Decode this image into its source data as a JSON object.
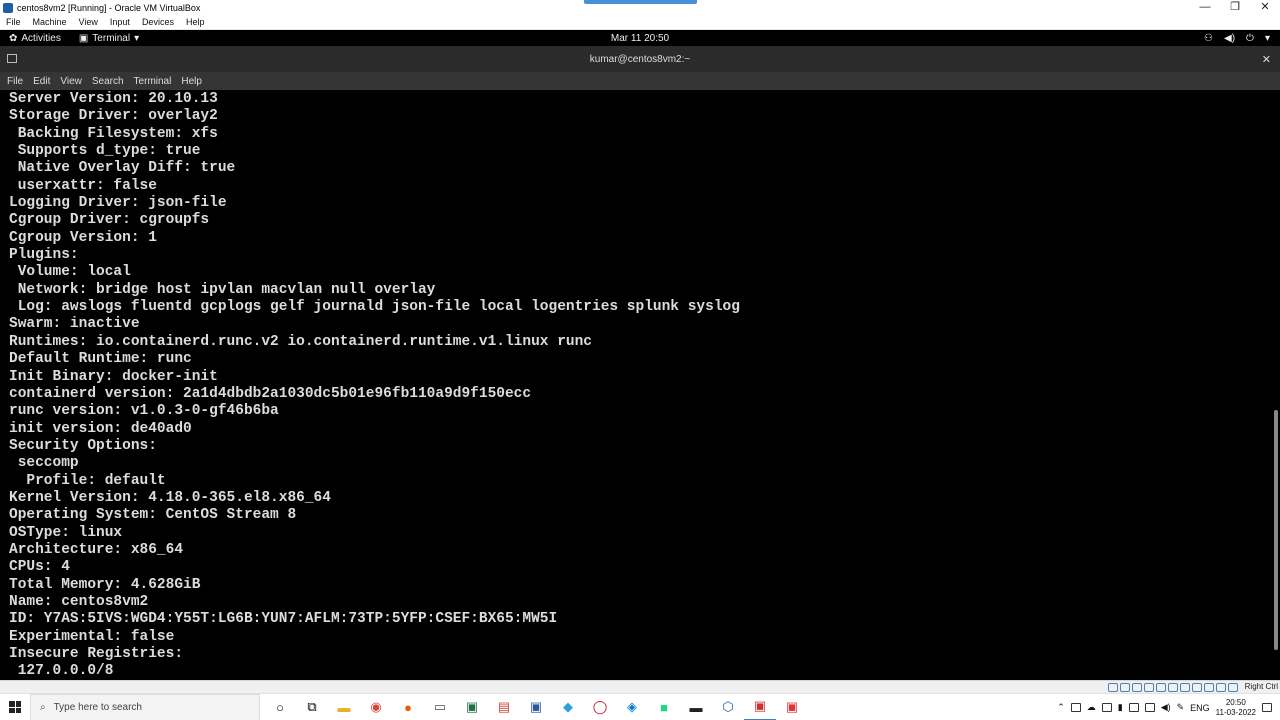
{
  "host_window": {
    "title": "centos8vm2 [Running] - Oracle VM VirtualBox",
    "controls": {
      "minimize": "—",
      "restore": "❐",
      "close": "✕"
    },
    "menu": [
      "File",
      "Machine",
      "View",
      "Input",
      "Devices",
      "Help"
    ]
  },
  "gnome_bar": {
    "activities_label": "Activities",
    "app_menu_label": "Terminal",
    "clock": "Mar 11  20:50",
    "status_icons": [
      "network-icon",
      "volume-icon",
      "power-icon",
      "chevron-down-icon"
    ]
  },
  "terminal": {
    "title": "kumar@centos8vm2:~",
    "menu": [
      "File",
      "Edit",
      "View",
      "Search",
      "Terminal",
      "Help"
    ],
    "lines": [
      "Server Version: 20.10.13",
      "Storage Driver: overlay2",
      " Backing Filesystem: xfs",
      " Supports d_type: true",
      " Native Overlay Diff: true",
      " userxattr: false",
      "Logging Driver: json-file",
      "Cgroup Driver: cgroupfs",
      "Cgroup Version: 1",
      "Plugins:",
      " Volume: local",
      " Network: bridge host ipvlan macvlan null overlay",
      " Log: awslogs fluentd gcplogs gelf journald json-file local logentries splunk syslog",
      "Swarm: inactive",
      "Runtimes: io.containerd.runc.v2 io.containerd.runtime.v1.linux runc",
      "Default Runtime: runc",
      "Init Binary: docker-init",
      "containerd version: 2a1d4dbdb2a1030dc5b01e96fb110a9d9f150ecc",
      "runc version: v1.0.3-0-gf46b6ba",
      "init version: de40ad0",
      "Security Options:",
      " seccomp",
      "  Profile: default",
      "Kernel Version: 4.18.0-365.el8.x86_64",
      "Operating System: CentOS Stream 8",
      "OSType: linux",
      "Architecture: x86_64",
      "CPUs: 4",
      "Total Memory: 4.628GiB",
      "Name: centos8vm2",
      "ID: Y7AS:5IVS:WGD4:Y55T:LG6B:YUN7:AFLM:73TP:5YFP:CSEF:BX65:MW5I",
      "Experimental: false",
      "Insecure Registries:",
      " 127.0.0.0/8"
    ]
  },
  "vb_status": {
    "host_key": "Right Ctrl"
  },
  "taskbar": {
    "search_placeholder": "Type here to search",
    "apps": [
      "cortana-icon",
      "task-view-icon",
      "file-explorer-icon",
      "chrome-icon",
      "firefox-icon",
      "mail-icon",
      "excel-icon",
      "snipping-icon",
      "word-icon",
      "telegram-icon",
      "opera-icon",
      "vscode-icon",
      "pycharm-icon",
      "terminal-icon",
      "virtualbox-icon",
      "virtualbox-vm-icon",
      "app-icon"
    ],
    "language": "ENG",
    "time": "20:50",
    "date": "11-03-2022"
  }
}
